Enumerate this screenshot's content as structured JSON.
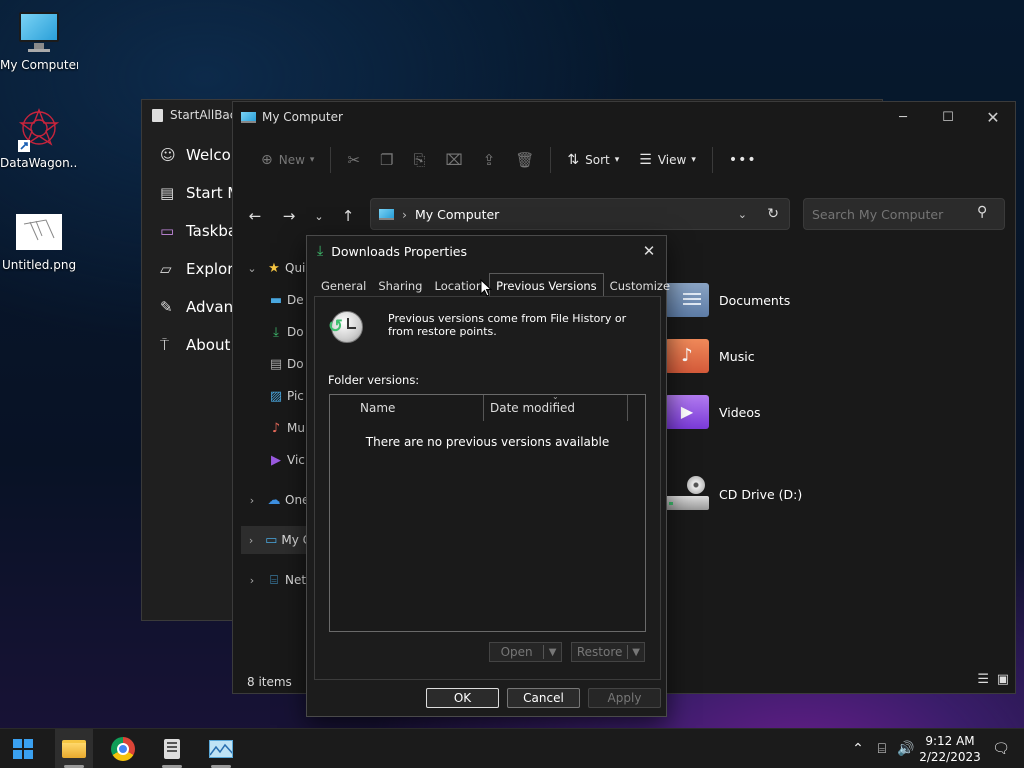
{
  "desktop": {
    "icons": [
      {
        "label": "My Computer",
        "icon": "monitor-icon"
      },
      {
        "label": "DataWagon...",
        "icon": "logo-icon"
      },
      {
        "label": "Untitled.png",
        "icon": "image-file-icon"
      }
    ]
  },
  "startallback": {
    "title": "StartAllBack",
    "nav": [
      "Welcom",
      "Start M",
      "Taskbar",
      "Explore",
      "Advanc",
      "About"
    ]
  },
  "explorer": {
    "title": "My Computer",
    "toolbar": {
      "new_label": "New",
      "sort_label": "Sort",
      "view_label": "View",
      "more_label": "•••"
    },
    "address": "My Computer",
    "search_placeholder": "Search My Computer",
    "sidebar": [
      "Quic",
      "De",
      "Do",
      "Do",
      "Pic",
      "Mu",
      "Vic",
      "One",
      "My C",
      "Netv"
    ],
    "folders": [
      "Documents",
      "Music",
      "Videos",
      "CD Drive (D:)"
    ],
    "status": "8 items"
  },
  "dialog": {
    "title": "Downloads Properties",
    "tabs": [
      "General",
      "Sharing",
      "Location",
      "Previous Versions",
      "Customize"
    ],
    "info": "Previous versions come from File History or from restore points.",
    "folder_versions_label": "Folder versions:",
    "columns": {
      "name": "Name",
      "date": "Date modified"
    },
    "empty_message": "There are no previous versions available",
    "buttons": {
      "open": "Open",
      "restore": "Restore",
      "ok": "OK",
      "cancel": "Cancel",
      "apply": "Apply"
    }
  },
  "taskbar": {
    "clock_time": "9:12 AM",
    "clock_date": "2/22/2023"
  }
}
